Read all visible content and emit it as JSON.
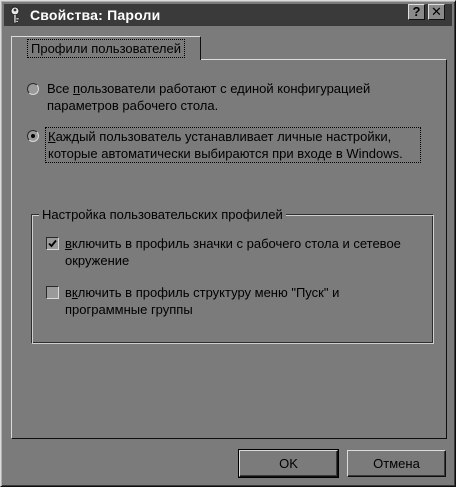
{
  "window": {
    "title": "Свойства: Пароли",
    "help_label": "?",
    "close_label": "✕"
  },
  "tabs": [
    {
      "label": "Профили пользователей",
      "selected": true
    }
  ],
  "profiles": {
    "option_all_prefix": "Все ",
    "option_all_accel": "п",
    "option_all_rest": "ользователи работают с единой конфигурацией параметров рабочего стола.",
    "option_all_checked": false,
    "option_each_accel": "К",
    "option_each_rest": "аждый пользователь устанавливает личные настройки, которые автоматически выбираются при входе в Windows.",
    "option_each_checked": true
  },
  "group": {
    "title": "Настройка пользовательских профилей",
    "check1_accel": "в",
    "check1_rest": "ключить в профиль значки с рабочего стола и сетевое окружение",
    "check1_checked": true,
    "check2_prefix": "в",
    "check2_accel": "к",
    "check2_rest": "лючить в профиль структуру меню \"Пуск\" и программные группы",
    "check2_checked": false
  },
  "buttons": {
    "ok": "OK",
    "cancel": "Отмена"
  }
}
